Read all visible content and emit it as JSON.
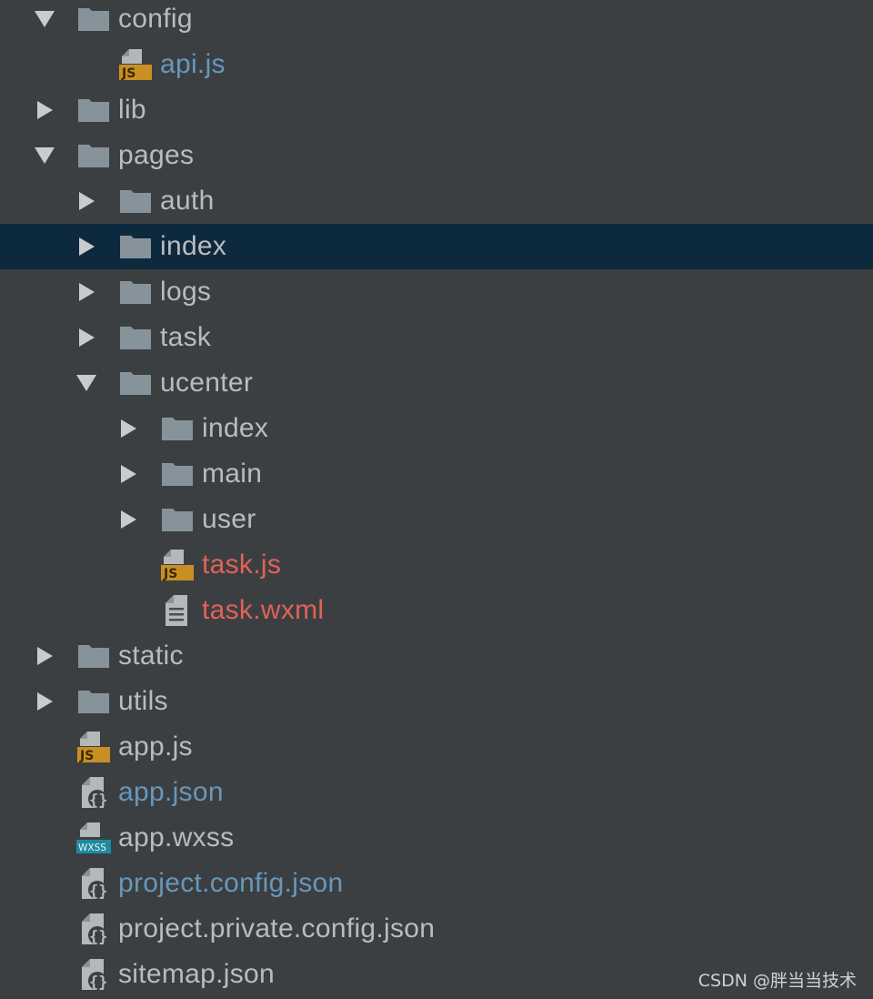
{
  "colors": {
    "background": "#3c3f41",
    "selected_row": "#0d293e",
    "text_default": "#bbbbbb",
    "text_modified_blue": "#6897bb",
    "text_untracked_red": "#e0625a",
    "folder_icon": "#87939a",
    "js_badge": "#c98f24",
    "wxss_badge": "#1f8aa0"
  },
  "tree": [
    {
      "label": "config",
      "type": "folder",
      "depth": 0,
      "arrow": "down",
      "color": "default",
      "icon": "folder-icon"
    },
    {
      "label": "api.js",
      "type": "js",
      "depth": 1,
      "arrow": "none",
      "color": "blue",
      "icon": "js-file-icon"
    },
    {
      "label": "lib",
      "type": "folder",
      "depth": 0,
      "arrow": "right",
      "color": "default",
      "icon": "folder-icon"
    },
    {
      "label": "pages",
      "type": "folder",
      "depth": 0,
      "arrow": "down",
      "color": "default",
      "icon": "folder-icon"
    },
    {
      "label": "auth",
      "type": "folder",
      "depth": 1,
      "arrow": "right",
      "color": "default",
      "icon": "folder-icon"
    },
    {
      "label": "index",
      "type": "folder",
      "depth": 1,
      "arrow": "right",
      "color": "default",
      "icon": "folder-icon",
      "selected": true
    },
    {
      "label": "logs",
      "type": "folder",
      "depth": 1,
      "arrow": "right",
      "color": "default",
      "icon": "folder-icon"
    },
    {
      "label": "task",
      "type": "folder",
      "depth": 1,
      "arrow": "right",
      "color": "default",
      "icon": "folder-icon"
    },
    {
      "label": "ucenter",
      "type": "folder",
      "depth": 1,
      "arrow": "down",
      "color": "default",
      "icon": "folder-icon"
    },
    {
      "label": "index",
      "type": "folder",
      "depth": 2,
      "arrow": "right",
      "color": "default",
      "icon": "folder-icon"
    },
    {
      "label": "main",
      "type": "folder",
      "depth": 2,
      "arrow": "right",
      "color": "default",
      "icon": "folder-icon"
    },
    {
      "label": "user",
      "type": "folder",
      "depth": 2,
      "arrow": "right",
      "color": "default",
      "icon": "folder-icon"
    },
    {
      "label": "task.js",
      "type": "js",
      "depth": 2,
      "arrow": "none",
      "color": "red",
      "icon": "js-file-icon"
    },
    {
      "label": "task.wxml",
      "type": "text",
      "depth": 2,
      "arrow": "none",
      "color": "red",
      "icon": "text-file-icon"
    },
    {
      "label": "static",
      "type": "folder",
      "depth": 0,
      "arrow": "right",
      "color": "default",
      "icon": "folder-icon"
    },
    {
      "label": "utils",
      "type": "folder",
      "depth": 0,
      "arrow": "right",
      "color": "default",
      "icon": "folder-icon"
    },
    {
      "label": "app.js",
      "type": "js",
      "depth": 0,
      "arrow": "none",
      "color": "default",
      "icon": "js-file-icon"
    },
    {
      "label": "app.json",
      "type": "json",
      "depth": 0,
      "arrow": "none",
      "color": "blue",
      "icon": "json-file-icon"
    },
    {
      "label": "app.wxss",
      "type": "wxss",
      "depth": 0,
      "arrow": "none",
      "color": "default",
      "icon": "wxss-file-icon"
    },
    {
      "label": "project.config.json",
      "type": "json",
      "depth": 0,
      "arrow": "none",
      "color": "blue",
      "icon": "json-file-icon"
    },
    {
      "label": "project.private.config.json",
      "type": "json",
      "depth": 0,
      "arrow": "none",
      "color": "default",
      "icon": "json-file-icon"
    },
    {
      "label": "sitemap.json",
      "type": "json",
      "depth": 0,
      "arrow": "none",
      "color": "default",
      "icon": "json-file-icon"
    }
  ],
  "badges": {
    "js": "JS",
    "wxss": "WXSS"
  },
  "watermark": "CSDN @胖当当技术"
}
